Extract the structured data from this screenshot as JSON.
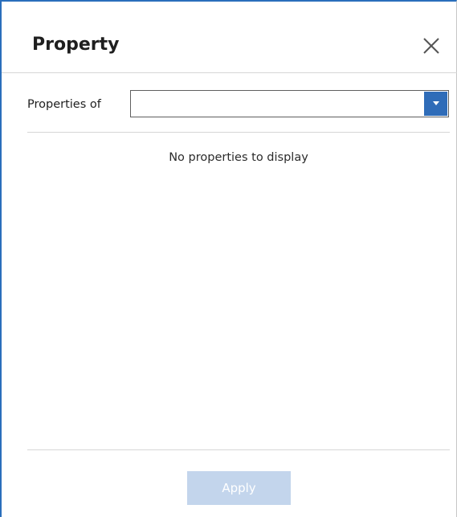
{
  "dialog": {
    "title": "Property",
    "close_icon": "close-icon"
  },
  "selector": {
    "label": "Properties of",
    "value": "",
    "arrow_icon": "chevron-down-icon",
    "arrow_color": "#2f6cb8"
  },
  "content": {
    "empty_message": "No properties to display"
  },
  "footer": {
    "apply_label": "Apply",
    "apply_disabled": true
  },
  "colors": {
    "accent": "#2a6ebb",
    "apply_disabled_bg": "#c3d5ec"
  }
}
